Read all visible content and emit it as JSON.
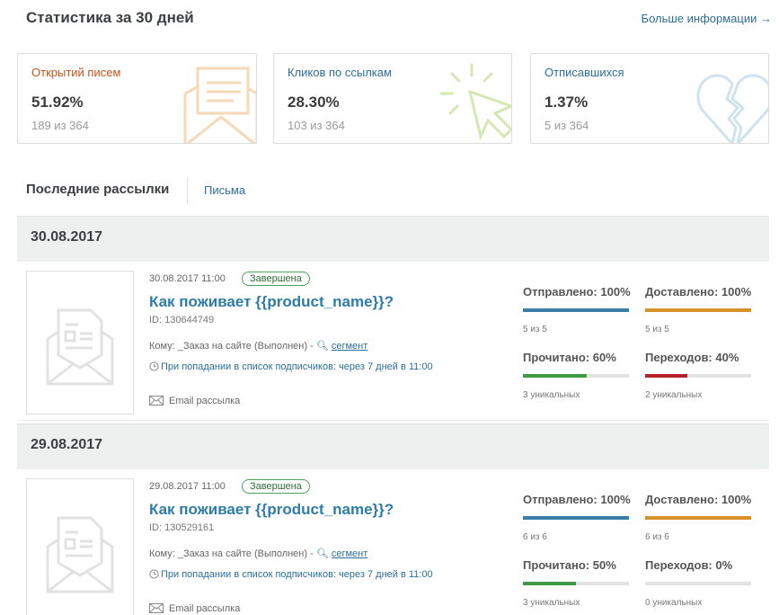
{
  "header": {
    "title": "Статистика за 30 дней",
    "more_link": "Больше информации →"
  },
  "stats": [
    {
      "label": "Открытий писем",
      "value": "51.92%",
      "sub": "189 из 364",
      "color": "#c8541a",
      "icon": "open-envelope-icon"
    },
    {
      "label": "Кликов по ссылкам",
      "value": "28.30%",
      "sub": "103 из 364",
      "color": "#2c6f96",
      "icon": "cursor-click-icon"
    },
    {
      "label": "Отписавшихся",
      "value": "1.37%",
      "sub": "5 из 364",
      "color": "#2c6f96",
      "icon": "broken-heart-icon"
    }
  ],
  "recent": {
    "title": "Последние рассылки",
    "tab_letters": "Письма"
  },
  "mailings": [
    {
      "date_header": "30.08.2017",
      "datetime": "30.08.2017 11:00",
      "status": "Завершена",
      "title": "Как поживает {{product_name}}?",
      "id": "ID: 130644749",
      "to_text": "Кому: _Заказ на сайте (Выполнен) -",
      "segment": "сегмент",
      "trigger": "При попадании в список подписчиков: через 7 дней в 11:00",
      "type": "Email рассылка",
      "metrics": [
        {
          "label": "Отправлено: 100%",
          "sub": "5 из 5",
          "progress": 1.0,
          "color": "#3a7ea8"
        },
        {
          "label": "Доставлено: 100%",
          "sub": "5 из 5",
          "progress": 1.0,
          "color": "#d9912a"
        },
        {
          "label": "Прочитано: 60%",
          "sub": "3 уникальных",
          "progress": 0.6,
          "color": "#3f9a45"
        },
        {
          "label": "Переходов: 40%",
          "sub": "2 уникальных",
          "progress": 0.4,
          "color": "#b5202a"
        }
      ]
    },
    {
      "date_header": "29.08.2017",
      "datetime": "29.08.2017 11:00",
      "status": "Завершена",
      "title": "Как поживает {{product_name}}?",
      "id": "ID: 130529161",
      "to_text": "Кому: _Заказ на сайте (Выполнен) -",
      "segment": "сегмент",
      "trigger": "При попадании в список подписчиков: через 7 дней в 11:00",
      "type": "Email рассылка",
      "metrics": [
        {
          "label": "Отправлено: 100%",
          "sub": "6 из 6",
          "progress": 1.0,
          "color": "#3a7ea8"
        },
        {
          "label": "Доставлено: 100%",
          "sub": "6 из 6",
          "progress": 1.0,
          "color": "#d9912a"
        },
        {
          "label": "Прочитано: 50%",
          "sub": "3 уникальных",
          "progress": 0.5,
          "color": "#3f9a45"
        },
        {
          "label": "Переходов: 0%",
          "sub": "0 уникальных",
          "progress": 0.0,
          "color": "#b5202a"
        }
      ]
    }
  ]
}
